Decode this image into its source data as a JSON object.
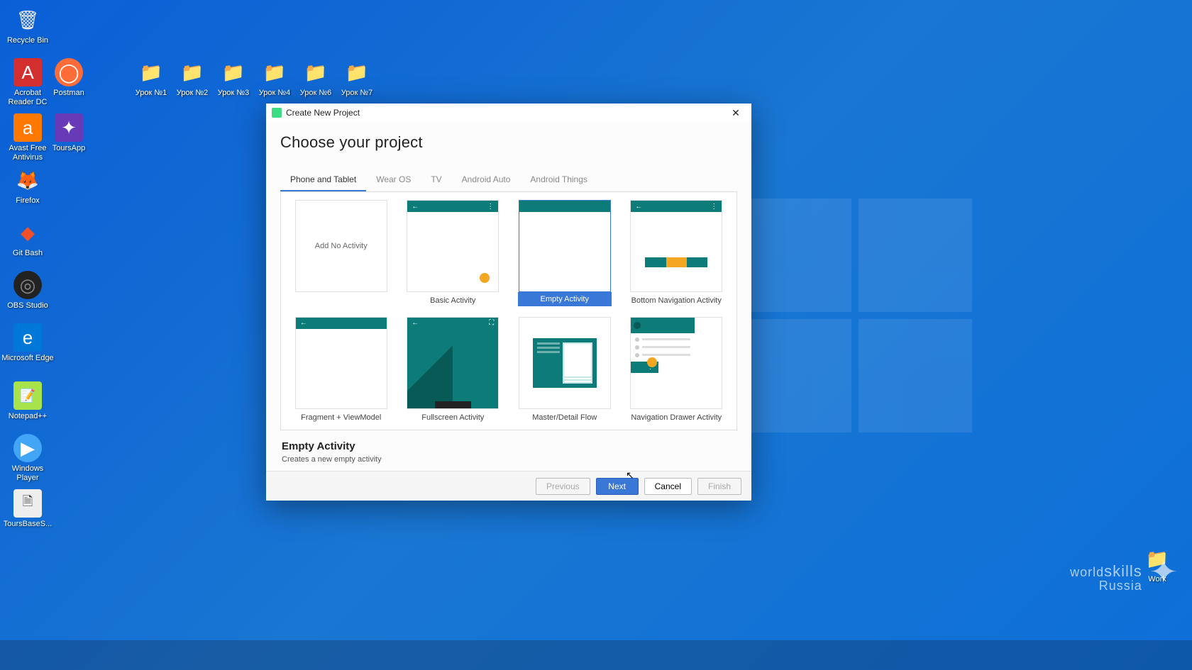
{
  "desktop_icons": {
    "recycle_bin": "Recycle Bin",
    "acrobat": "Acrobat Reader DC",
    "postman": "Postman",
    "avast": "Avast Free Antivirus",
    "toursapp": "ToursApp",
    "firefox": "Firefox",
    "gitbash": "Git Bash",
    "obs": "OBS Studio",
    "edge": "Microsoft Edge",
    "notepadpp": "Notepad++",
    "wmplayer": "Windows Player",
    "toursbase": "ToursBaseS...",
    "lesson1": "Урок №1",
    "lesson2": "Урок №2",
    "lesson3": "Урок №3",
    "lesson4": "Урок №4",
    "lesson5": "Урок №6",
    "lesson6": "Урок №7",
    "work": "Work"
  },
  "dialog": {
    "title": "Create New Project",
    "heading": "Choose your project",
    "tabs": [
      "Phone and Tablet",
      "Wear OS",
      "TV",
      "Android Auto",
      "Android Things"
    ],
    "templates": [
      "Add No Activity",
      "Basic Activity",
      "Empty Activity",
      "Bottom Navigation Activity",
      "Fragment + ViewModel",
      "Fullscreen Activity",
      "Master/Detail Flow",
      "Navigation Drawer Activity"
    ],
    "selected_title": "Empty Activity",
    "selected_desc": "Creates a new empty activity",
    "buttons": {
      "previous": "Previous",
      "next": "Next",
      "cancel": "Cancel",
      "finish": "Finish"
    }
  },
  "watermark": {
    "line1": "world",
    "line2": "skills",
    "line3": "Russia"
  }
}
